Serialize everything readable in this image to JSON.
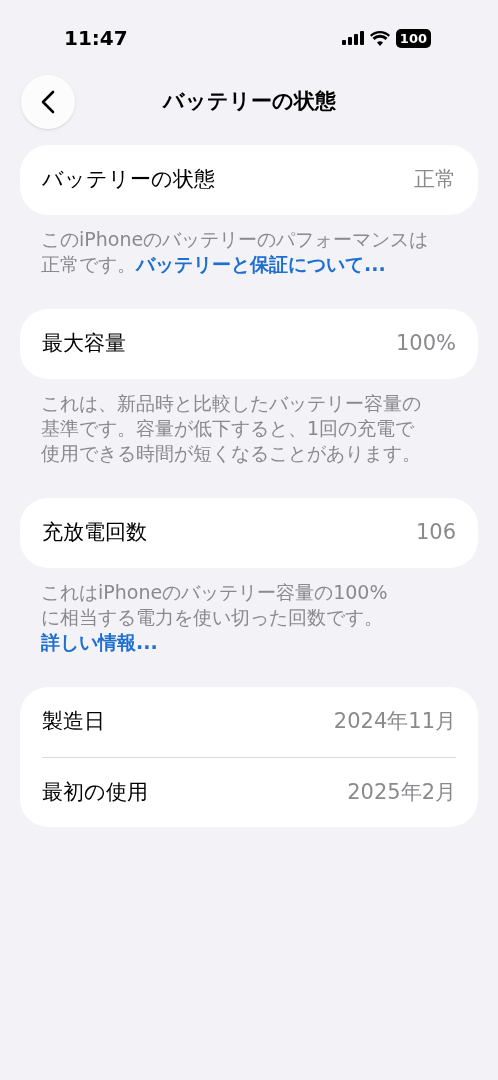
{
  "status_bar": {
    "time": "11:47",
    "battery": "100"
  },
  "nav": {
    "title": "バッテリーの状態"
  },
  "sections": [
    {
      "rows": [
        {
          "label": "バッテリーの状態",
          "value": "正常"
        }
      ],
      "note": {
        "text": "このiPhoneのバッテリーのパフォーマンスは正常です。",
        "link": "バッテリーと保証について..."
      }
    },
    {
      "rows": [
        {
          "label": "最大容量",
          "value": "100%"
        }
      ],
      "note": {
        "text": "これは、新品時と比較したバッテリー容量の基準です。容量が低下すると、1回の充電で使用できる時間が短くなることがあります。"
      }
    },
    {
      "rows": [
        {
          "label": "充放電回数",
          "value": "106"
        }
      ],
      "note": {
        "text": "これはiPhoneのバッテリー容量の100%に相当する電力を使い切った回数です。",
        "link": "詳しい情報..."
      }
    },
    {
      "rows": [
        {
          "label": "製造日",
          "value": "2024年11月"
        },
        {
          "label": "最初の使用",
          "value": "2025年2月"
        }
      ]
    }
  ]
}
